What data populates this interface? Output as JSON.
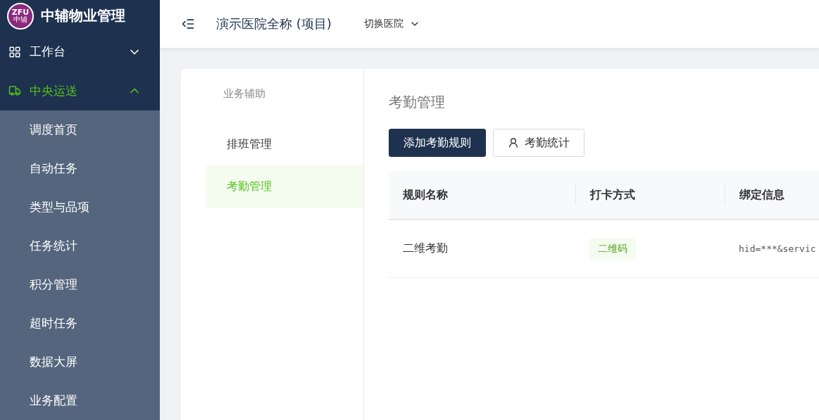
{
  "brand": {
    "logo_text": "ZFU",
    "logo_sub": "中辅",
    "title": "中辅物业管理"
  },
  "sidebar": {
    "items": [
      {
        "label": "工作台",
        "expanded": false,
        "selected": false
      },
      {
        "label": "中央运送",
        "expanded": true,
        "selected": true,
        "children": [
          {
            "label": "调度首页"
          },
          {
            "label": "自动任务"
          },
          {
            "label": "类型与品项"
          },
          {
            "label": "任务统计"
          },
          {
            "label": "积分管理"
          },
          {
            "label": "超时任务"
          },
          {
            "label": "数据大屏"
          },
          {
            "label": "业务配置"
          }
        ]
      }
    ]
  },
  "header": {
    "project": "演示医院全称 (项目)",
    "switch_label": "切换医院"
  },
  "subnav": {
    "title": "业务辅助",
    "items": [
      {
        "label": "排班管理",
        "selected": false
      },
      {
        "label": "考勤管理",
        "selected": true
      }
    ]
  },
  "content": {
    "title": "考勤管理",
    "buttons": [
      {
        "label": "添加考勤规则",
        "kind": "primary"
      },
      {
        "label": "考勤统计",
        "kind": "default"
      }
    ],
    "table": {
      "columns": [
        "规则名称",
        "打卡方式",
        "绑定信息"
      ],
      "rows": [
        {
          "name": "二维考勤",
          "method": "二维码",
          "binding": "hid=***&servic"
        }
      ]
    }
  }
}
